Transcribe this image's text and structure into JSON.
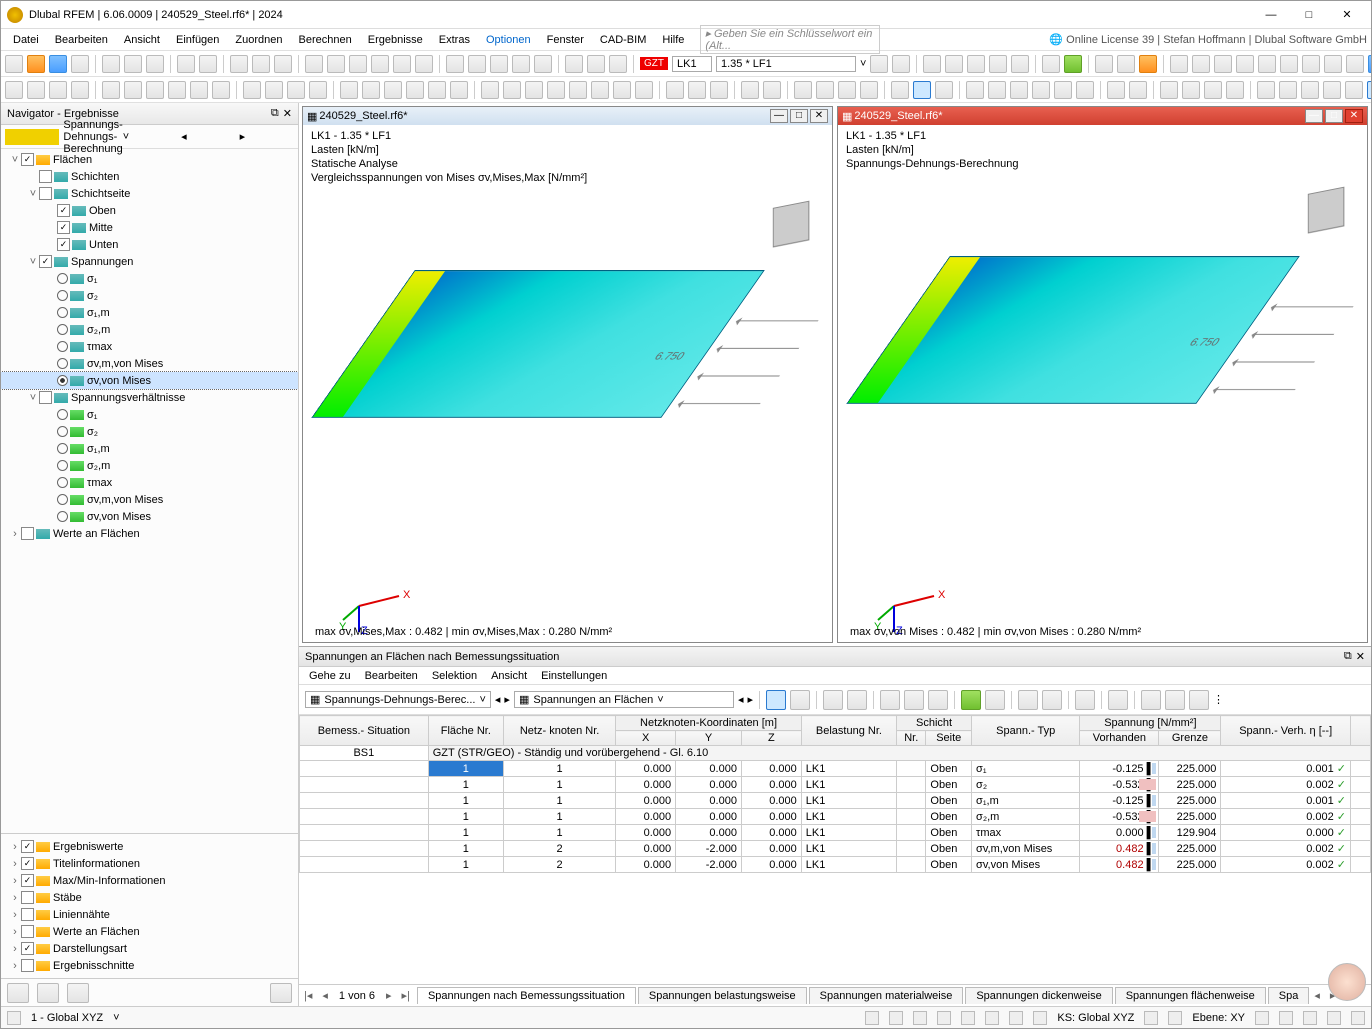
{
  "app": {
    "title": "Dlubal RFEM | 6.06.0009 | 240529_Steel.rf6* | 2024",
    "license": "Online License 39 | Stefan Hoffmann | Dlubal Software GmbH",
    "keyword_placeholder": "Geben Sie ein Schlüsselwort ein (Alt..."
  },
  "menu": [
    "Datei",
    "Bearbeiten",
    "Ansicht",
    "Einfügen",
    "Zuordnen",
    "Berechnen",
    "Ergebnisse",
    "Extras",
    "Optionen",
    "Fenster",
    "CAD-BIM",
    "Hilfe"
  ],
  "menu_hl_index": 8,
  "toolbar1": {
    "gzt": "GZT",
    "lc": "LK1",
    "combo": "1.35 * LF1"
  },
  "navigator": {
    "title": "Navigator - Ergebnisse",
    "selector": "Spannungs-Dehnungs-Berechnung",
    "tree": [
      {
        "lvl": 0,
        "ar": "v",
        "ck": true,
        "ic": "y",
        "t": "Flächen"
      },
      {
        "lvl": 1,
        "sq": false,
        "ic": "b",
        "t": "Schichten"
      },
      {
        "lvl": 1,
        "ar": "v",
        "sq": false,
        "ic": "b",
        "t": "Schichtseite"
      },
      {
        "lvl": 2,
        "ck": true,
        "ic": "b",
        "t": "Oben"
      },
      {
        "lvl": 2,
        "ck": true,
        "ic": "b",
        "t": "Mitte"
      },
      {
        "lvl": 2,
        "ck": true,
        "ic": "b",
        "t": "Unten"
      },
      {
        "lvl": 1,
        "ar": "v",
        "ck": true,
        "ic": "b",
        "t": "Spannungen"
      },
      {
        "lvl": 2,
        "rd": false,
        "ic": "b",
        "t": "σ₁"
      },
      {
        "lvl": 2,
        "rd": false,
        "ic": "b",
        "t": "σ₂"
      },
      {
        "lvl": 2,
        "rd": false,
        "ic": "b",
        "t": "σ₁,m"
      },
      {
        "lvl": 2,
        "rd": false,
        "ic": "b",
        "t": "σ₂,m"
      },
      {
        "lvl": 2,
        "rd": false,
        "ic": "b",
        "t": "τmax"
      },
      {
        "lvl": 2,
        "rd": false,
        "ic": "b",
        "t": "σv,m,von Mises"
      },
      {
        "lvl": 2,
        "rd": true,
        "ic": "b",
        "t": "σv,von Mises",
        "sel": true
      },
      {
        "lvl": 1,
        "ar": "v",
        "sq": false,
        "ic": "b",
        "t": "Spannungsverhältnisse"
      },
      {
        "lvl": 2,
        "rd": false,
        "ic": "g",
        "t": "σ₁"
      },
      {
        "lvl": 2,
        "rd": false,
        "ic": "g",
        "t": "σ₂"
      },
      {
        "lvl": 2,
        "rd": false,
        "ic": "g",
        "t": "σ₁,m"
      },
      {
        "lvl": 2,
        "rd": false,
        "ic": "g",
        "t": "σ₂,m"
      },
      {
        "lvl": 2,
        "rd": false,
        "ic": "g",
        "t": "τmax"
      },
      {
        "lvl": 2,
        "rd": false,
        "ic": "g",
        "t": "σv,m,von Mises"
      },
      {
        "lvl": 2,
        "rd": false,
        "ic": "g",
        "t": "σv,von Mises"
      },
      {
        "lvl": 0,
        "ar": ">",
        "sq": false,
        "t": "Werte an Flächen"
      }
    ],
    "bottom": [
      {
        "ck": true,
        "t": "Ergebniswerte"
      },
      {
        "ck": true,
        "t": "Titelinformationen"
      },
      {
        "ck": true,
        "t": "Max/Min-Informationen"
      },
      {
        "ck": false,
        "t": "Stäbe"
      },
      {
        "ck": false,
        "t": "Liniennähte"
      },
      {
        "ck": false,
        "t": "Werte an Flächen"
      },
      {
        "ck": true,
        "t": "Darstellungsart"
      },
      {
        "ck": false,
        "t": "Ergebnisschnitte"
      }
    ]
  },
  "view1": {
    "tab": "240529_Steel.rf6*",
    "l1": "LK1 - 1.35 * LF1",
    "l2": "Lasten [kN/m]",
    "l3": "Statische Analyse",
    "l4": "Vergleichsspannungen von Mises σv,Mises,Max [N/mm²]",
    "load": "6.750",
    "stat": "max σv,Mises,Max : 0.482 | min σv,Mises,Max : 0.280 N/mm²"
  },
  "view2": {
    "tab": "240529_Steel.rf6*",
    "l1": "LK1 - 1.35 * LF1",
    "l2": "Lasten [kN/m]",
    "l3": "Spannungs-Dehnungs-Berechnung",
    "load": "6.750",
    "stat": "max σv,von Mises : 0.482 | min σv,von Mises : 0.280 N/mm²"
  },
  "results": {
    "title": "Spannungen an Flächen nach Bemessungssituation",
    "menu": [
      "Gehe zu",
      "Bearbeiten",
      "Selektion",
      "Ansicht",
      "Einstellungen"
    ],
    "combo1": "Spannungs-Dehnungs-Berec...",
    "combo2": "Spannungen an Flächen",
    "headers": {
      "h1": "Bemess.-\nSituation",
      "h2": "Fläche\nNr.",
      "h3": "Netz-\nknoten Nr.",
      "hg": "Netzknoten-Koordinaten [m]",
      "hx": "X",
      "hy": "Y",
      "hz": "Z",
      "h4": "Belastung\nNr.",
      "hg2": "Schicht",
      "h5": "Nr.",
      "h6": "Seite",
      "h7": "Spann.-\nTyp",
      "hg3": "Spannung [N/mm²]",
      "h8": "Vorhanden",
      "h9": "Grenze",
      "h10": "Spann.-\nVerh. η [--]"
    },
    "bs": "BS1",
    "group": "GZT (STR/GEO) - Ständig und vorübergehend - Gl. 6.10",
    "rows": [
      {
        "f": "1",
        "n": "1",
        "x": "0.000",
        "y": "0.000",
        "z": "0.000",
        "lk": "LK1",
        "side": "Oben",
        "typ": "σ₁",
        "v": "-0.125",
        "g": "225.000",
        "r": "0.001"
      },
      {
        "f": "1",
        "n": "1",
        "x": "0.000",
        "y": "0.000",
        "z": "0.000",
        "lk": "LK1",
        "side": "Oben",
        "typ": "σ₂",
        "v": "-0.532",
        "g": "225.000",
        "r": "0.002",
        "neg": true
      },
      {
        "f": "1",
        "n": "1",
        "x": "0.000",
        "y": "0.000",
        "z": "0.000",
        "lk": "LK1",
        "side": "Oben",
        "typ": "σ₁,m",
        "v": "-0.125",
        "g": "225.000",
        "r": "0.001"
      },
      {
        "f": "1",
        "n": "1",
        "x": "0.000",
        "y": "0.000",
        "z": "0.000",
        "lk": "LK1",
        "side": "Oben",
        "typ": "σ₂,m",
        "v": "-0.532",
        "g": "225.000",
        "r": "0.002",
        "neg": true
      },
      {
        "f": "1",
        "n": "1",
        "x": "0.000",
        "y": "0.000",
        "z": "0.000",
        "lk": "LK1",
        "side": "Oben",
        "typ": "τmax",
        "v": "0.000",
        "g": "129.904",
        "r": "0.000"
      },
      {
        "f": "1",
        "n": "2",
        "x": "0.000",
        "y": "-2.000",
        "z": "0.000",
        "lk": "LK1",
        "side": "Oben",
        "typ": "σv,m,von Mises",
        "v": "0.482",
        "g": "225.000",
        "r": "0.002",
        "red": true
      },
      {
        "f": "1",
        "n": "2",
        "x": "0.000",
        "y": "-2.000",
        "z": "0.000",
        "lk": "LK1",
        "side": "Oben",
        "typ": "σv,von Mises",
        "v": "0.482",
        "g": "225.000",
        "r": "0.002",
        "red": true
      }
    ],
    "page": "1 von 6",
    "tabs": [
      "Spannungen nach Bemessungssituation",
      "Spannungen belastungsweise",
      "Spannungen materialweise",
      "Spannungen dickenweise",
      "Spannungen flächenweise",
      "Spa"
    ]
  },
  "status": {
    "cs": "1 - Global XYZ",
    "ks": "KS: Global XYZ",
    "eb": "Ebene: XY"
  }
}
